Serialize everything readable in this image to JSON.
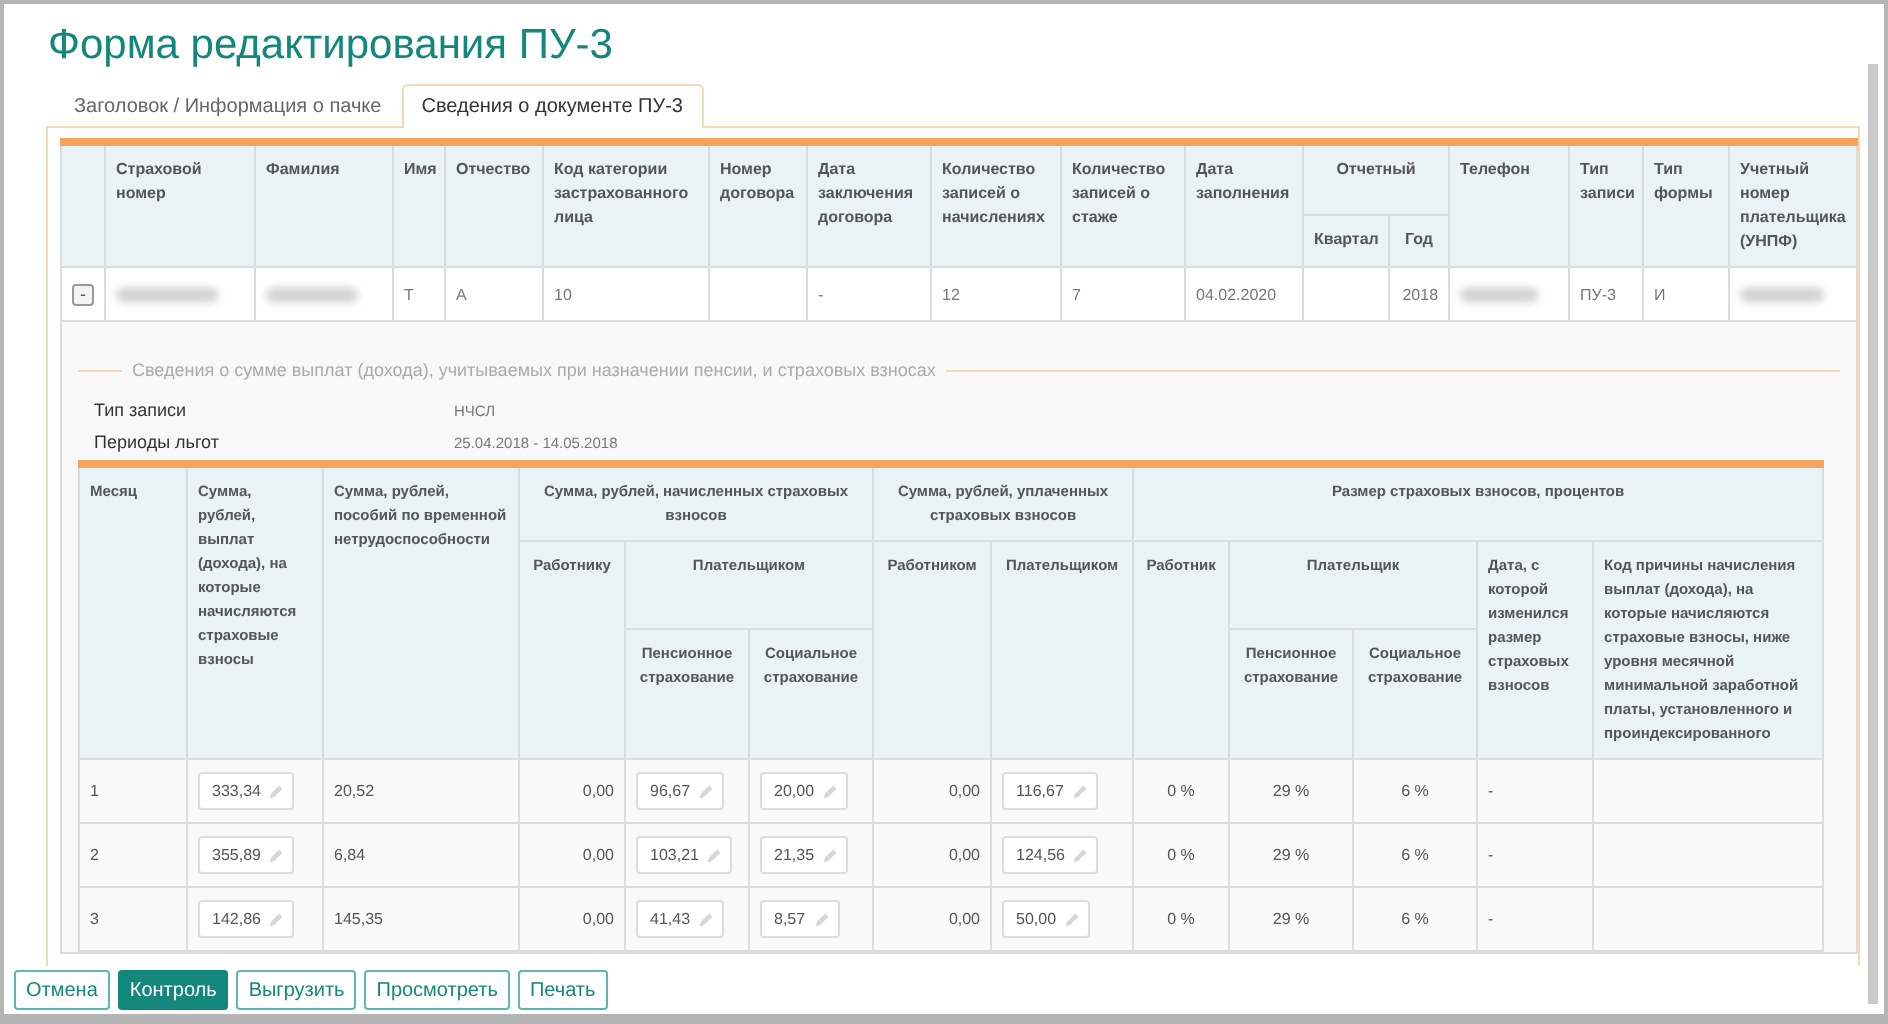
{
  "title": "Форма редактирования ПУ-3",
  "tabs": [
    {
      "label": "Заголовок / Информация о пачке",
      "selected": false
    },
    {
      "label": "Сведения о документе ПУ-3",
      "selected": true
    }
  ],
  "document_table": {
    "columns": [
      {
        "label": "Страховой номер"
      },
      {
        "label": "Фамилия"
      },
      {
        "label": "Имя"
      },
      {
        "label": "Отчество"
      },
      {
        "label": "Код категории застрахованного лица"
      },
      {
        "label": "Номер договора"
      },
      {
        "label": "Дата заключения договора"
      },
      {
        "label": "Количество записей о начислениях"
      },
      {
        "label": "Количество записей о стаже"
      },
      {
        "label": "Дата заполнения"
      },
      {
        "label": "Отчетный",
        "colspan": 2,
        "children": [
          {
            "label": "Квартал"
          },
          {
            "label": "Год"
          }
        ]
      },
      {
        "label": "Телефон"
      },
      {
        "label": "Тип записи"
      },
      {
        "label": "Тип формы"
      },
      {
        "label": "Учетный номер плательщика (УНПФ)"
      }
    ],
    "rows": [
      {
        "toggle": "-",
        "expanded": true,
        "cells": [
          {
            "kind": "redacted"
          },
          {
            "kind": "redacted"
          },
          {
            "kind": "text",
            "text": "Т"
          },
          {
            "kind": "text",
            "text": "А"
          },
          {
            "kind": "text",
            "text": "10"
          },
          {
            "kind": "empty"
          },
          {
            "kind": "text",
            "text": "-"
          },
          {
            "kind": "text",
            "text": "12"
          },
          {
            "kind": "text",
            "text": "7"
          },
          {
            "kind": "text",
            "text": "04.02.2020"
          },
          {
            "kind": "empty"
          },
          {
            "kind": "text",
            "text": "2018"
          },
          {
            "kind": "redacted"
          },
          {
            "kind": "text",
            "text": "ПУ-3"
          },
          {
            "kind": "text",
            "text": "И"
          },
          {
            "kind": "redacted"
          }
        ]
      }
    ]
  },
  "details": {
    "legend": "Сведения о сумме выплат (дохода), учитываемых при назначении пенсии, и страховых взносах",
    "fields": [
      {
        "label": "Тип записи",
        "value": "НЧСЛ"
      },
      {
        "label": "Периоды льгот",
        "value": "25.04.2018 - 14.05.2018"
      }
    ],
    "payments_table": {
      "columns": [
        {
          "label": "Месяц"
        },
        {
          "label": "Сумма, рублей, выплат (дохода), на которые начисляются страховые взносы"
        },
        {
          "label": "Сумма, рублей, пособий по временной нетрудоспособности"
        },
        {
          "label": "Сумма, рублей, начисленных страховых взносов",
          "colspan": 3,
          "children": [
            {
              "label": "Работнику"
            },
            {
              "label": "Плательщиком",
              "colspan": 2,
              "children": [
                {
                  "label": "Пенсионное страхование"
                },
                {
                  "label": "Социальное страхование"
                }
              ]
            }
          ]
        },
        {
          "label": "Сумма, рублей, уплаченных страховых взносов",
          "colspan": 2,
          "children": [
            {
              "label": "Работником"
            },
            {
              "label": "Плательщиком"
            }
          ]
        },
        {
          "label": "Размер страховых взносов, процентов",
          "colspan": 5,
          "children": [
            {
              "label": "Работник"
            },
            {
              "label": "Плательщик",
              "colspan": 2,
              "children": [
                {
                  "label": "Пенсионное страхование"
                },
                {
                  "label": "Социальное страхование"
                }
              ]
            },
            {
              "label": "Дата, с которой изменился размер страховых взносов"
            },
            {
              "label": "Код причины начисления выплат (дохода), на которые начисляются страховые взносы, ниже уровня месячной минимальной заработной платы, установленного и проиндексированного"
            }
          ]
        }
      ],
      "rows": [
        {
          "cells": [
            {
              "kind": "text",
              "text": "1"
            },
            {
              "kind": "input",
              "value": "333,34"
            },
            {
              "kind": "text",
              "text": "20,52"
            },
            {
              "kind": "text",
              "text": "0,00"
            },
            {
              "kind": "input",
              "value": "96,67"
            },
            {
              "kind": "input",
              "value": "20,00"
            },
            {
              "kind": "text",
              "text": "0,00"
            },
            {
              "kind": "input",
              "value": "116,67"
            },
            {
              "kind": "text",
              "text": "0 %"
            },
            {
              "kind": "text",
              "text": "29 %"
            },
            {
              "kind": "text",
              "text": "6 %"
            },
            {
              "kind": "text",
              "text": "-"
            },
            {
              "kind": "empty"
            }
          ]
        },
        {
          "cells": [
            {
              "kind": "text",
              "text": "2"
            },
            {
              "kind": "input",
              "value": "355,89"
            },
            {
              "kind": "text",
              "text": "6,84"
            },
            {
              "kind": "text",
              "text": "0,00"
            },
            {
              "kind": "input",
              "value": "103,21"
            },
            {
              "kind": "input",
              "value": "21,35"
            },
            {
              "kind": "text",
              "text": "0,00"
            },
            {
              "kind": "input",
              "value": "124,56"
            },
            {
              "kind": "text",
              "text": "0 %"
            },
            {
              "kind": "text",
              "text": "29 %"
            },
            {
              "kind": "text",
              "text": "6 %"
            },
            {
              "kind": "text",
              "text": "-"
            },
            {
              "kind": "empty"
            }
          ]
        },
        {
          "cells": [
            {
              "kind": "text",
              "text": "3"
            },
            {
              "kind": "input",
              "value": "142,86"
            },
            {
              "kind": "text",
              "text": "145,35"
            },
            {
              "kind": "text",
              "text": "0,00"
            },
            {
              "kind": "input",
              "value": "41,43"
            },
            {
              "kind": "input",
              "value": "8,57"
            },
            {
              "kind": "text",
              "text": "0,00"
            },
            {
              "kind": "input",
              "value": "50,00"
            },
            {
              "kind": "text",
              "text": "0 %"
            },
            {
              "kind": "text",
              "text": "29 %"
            },
            {
              "kind": "text",
              "text": "6 %"
            },
            {
              "kind": "text",
              "text": "-"
            },
            {
              "kind": "empty"
            }
          ]
        }
      ]
    }
  },
  "buttons": [
    {
      "label": "Отмена",
      "kind": "default"
    },
    {
      "label": "Контроль",
      "kind": "primary"
    },
    {
      "label": "Выгрузить",
      "kind": "default"
    },
    {
      "label": "Просмотреть",
      "kind": "default"
    },
    {
      "label": "Печать",
      "kind": "default"
    }
  ]
}
